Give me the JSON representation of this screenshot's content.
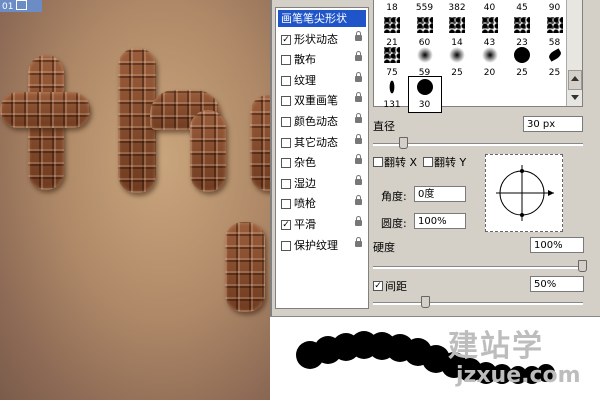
{
  "document": {
    "tab_label": "01"
  },
  "options": [
    {
      "label": "画笔笔尖形状",
      "checked": null,
      "header": true
    },
    {
      "label": "形状动态",
      "checked": true
    },
    {
      "label": "散布",
      "checked": false
    },
    {
      "label": "纹理",
      "checked": false
    },
    {
      "label": "双重画笔",
      "checked": false
    },
    {
      "label": "颜色动态",
      "checked": false
    },
    {
      "label": "其它动态",
      "checked": false
    },
    {
      "label": "杂色",
      "checked": false
    },
    {
      "label": "湿边",
      "checked": false
    },
    {
      "label": "喷枪",
      "checked": false
    },
    {
      "label": "平滑",
      "checked": true
    },
    {
      "label": "保护纹理",
      "checked": false
    }
  ],
  "tips": {
    "row1": [
      "18",
      "559",
      "382",
      "40",
      "45",
      "90"
    ],
    "row2": [
      "21",
      "60",
      "14",
      "43",
      "23",
      "58"
    ],
    "row3": [
      "75",
      "59",
      "25",
      "20",
      "25",
      "25"
    ],
    "row4": [
      "131",
      "30"
    ]
  },
  "brush": {
    "diameter_label": "直径",
    "diameter_value": "30 px",
    "flip_x_label": "翻转 X",
    "flip_y_label": "翻转 Y",
    "angle_label": "角度:",
    "angle_value": "0度",
    "roundness_label": "圆度:",
    "roundness_value": "100%",
    "hardness_label": "硬度",
    "hardness_value": "100%",
    "spacing_label": "间距",
    "spacing_value": "50%",
    "spacing_checked": true
  },
  "watermark": {
    "line1": "建站学",
    "line2": "jzxue.com"
  }
}
